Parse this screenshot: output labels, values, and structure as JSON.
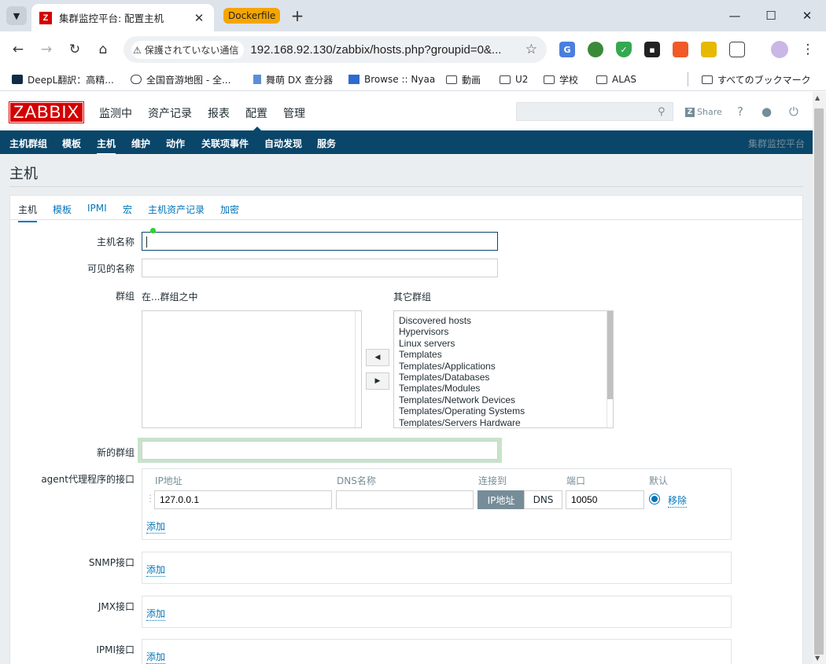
{
  "browser": {
    "active_tab_title": "集群监控平台: 配置主机",
    "tab_group_label": "Dockerfile",
    "security_chip": "保護されていない通信",
    "url": "192.168.92.130/zabbix/hosts.php?groupid=0&...",
    "bookmarks": [
      {
        "label": "DeepL翻訳：高精..."
      },
      {
        "label": "全国音游地图 - 全..."
      },
      {
        "label": "舞萌 DX 查分器"
      },
      {
        "label": "Browse :: Nyaa"
      },
      {
        "label": "動画"
      },
      {
        "label": "U2"
      },
      {
        "label": "学校"
      },
      {
        "label": "ALAS"
      },
      {
        "label": "すべてのブックマーク"
      }
    ]
  },
  "zabbix": {
    "logo": "ZABBIX",
    "top_menu": [
      "监测中",
      "资产记录",
      "报表",
      "配置",
      "管理"
    ],
    "share_label": "Share",
    "sub_menu": [
      "主机群组",
      "模板",
      "主机",
      "维护",
      "动作",
      "关联项事件",
      "自动发现",
      "服务"
    ],
    "brand_label": "集群监控平台",
    "page_title": "主机",
    "form_tabs": [
      "主机",
      "模板",
      "IPMI",
      "宏",
      "主机资产记录",
      "加密"
    ],
    "labels": {
      "host_name": "主机名称",
      "visible_name": "可见的名称",
      "groups": "群组",
      "in_groups": "在...群组之中",
      "other_groups": "其它群组",
      "new_group": "新的群组",
      "agent_iface": "agent代理程序的接口",
      "snmp_iface": "SNMP接口",
      "jmx_iface": "JMX接口",
      "ipmi_iface": "IPMI接口"
    },
    "host_name_value": "",
    "visible_name_value": "",
    "new_group_value": "",
    "other_groups_list": [
      "Discovered hosts",
      "Hypervisors",
      "Linux servers",
      "Templates",
      "Templates/Applications",
      "Templates/Databases",
      "Templates/Modules",
      "Templates/Network Devices",
      "Templates/Operating Systems",
      "Templates/Servers Hardware"
    ],
    "iface_headers": {
      "ip": "IP地址",
      "dns": "DNS名称",
      "connect": "连接到",
      "port": "端口",
      "default": "默认"
    },
    "agent": {
      "ip": "127.0.0.1",
      "dns": "",
      "connect_ip": "IP地址",
      "connect_dns": "DNS",
      "port": "10050",
      "remove": "移除",
      "add": "添加"
    },
    "add_label": "添加"
  }
}
